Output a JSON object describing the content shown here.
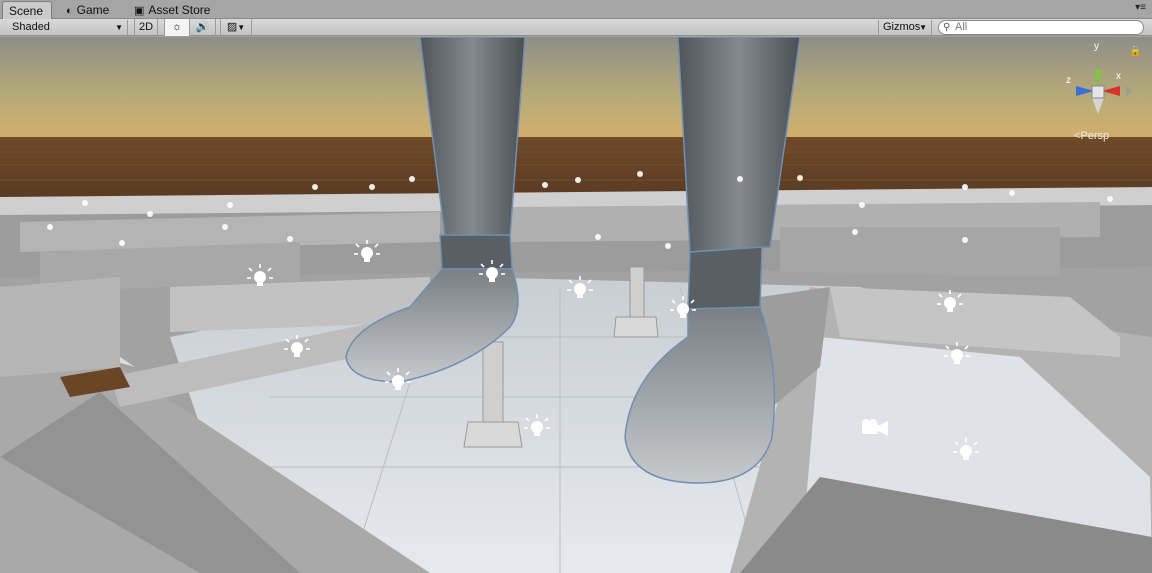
{
  "tabs": [
    {
      "label": "Scene",
      "icon": "scene-icon",
      "active": true
    },
    {
      "label": "Game",
      "icon": "game-icon",
      "active": false
    },
    {
      "label": "Asset Store",
      "icon": "store-icon",
      "active": false
    }
  ],
  "toolbar": {
    "draw_mode": "Shaded",
    "mode_2d_label": "2D",
    "lighting_icon": "sun-icon",
    "audio_icon": "speaker-icon",
    "effects_icon": "image-icon",
    "gizmos_label": "Gizmos",
    "search_placeholder": "All"
  },
  "scene_gizmo": {
    "projection_label": "Persp",
    "axis_y": "y",
    "axis_x": "x",
    "axis_z": "z",
    "colors": {
      "x": "#d8322b",
      "y": "#7fc742",
      "z": "#3a6ed8"
    }
  },
  "scene": {
    "object_icons": [
      "light-icon",
      "camera-icon"
    ]
  }
}
